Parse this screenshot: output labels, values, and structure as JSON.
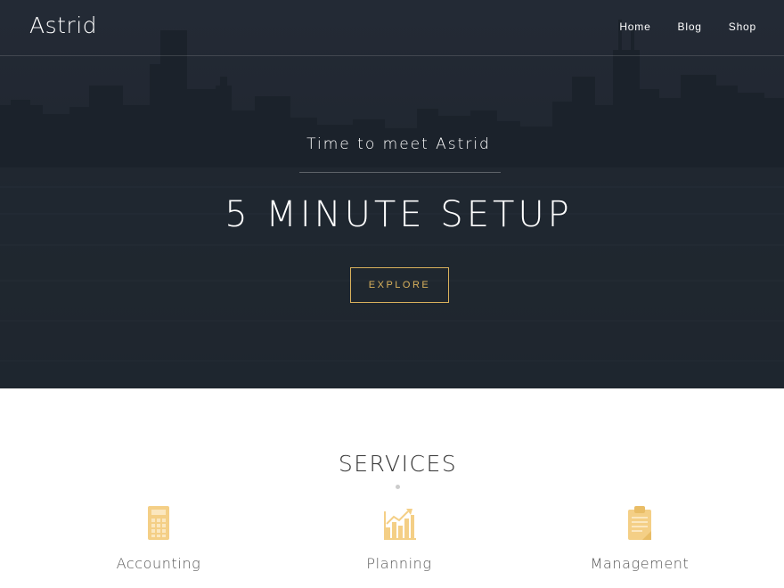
{
  "header": {
    "logo": "Astrid",
    "nav": [
      {
        "label": "Home"
      },
      {
        "label": "Blog"
      },
      {
        "label": "Shop"
      }
    ]
  },
  "hero": {
    "subtitle": "Time to meet Astrid",
    "headline": "5 MINUTE SETUP",
    "button_label": "EXPLORE"
  },
  "services": {
    "title": "SERVICES",
    "items": [
      {
        "label": "Accounting",
        "icon": "calculator-icon"
      },
      {
        "label": "Planning",
        "icon": "bar-chart-icon"
      },
      {
        "label": "Management",
        "icon": "clipboard-icon"
      }
    ]
  },
  "colors": {
    "accent": "#d9b15c",
    "icon": "#f4cf86",
    "hero_bg": "#283039"
  }
}
